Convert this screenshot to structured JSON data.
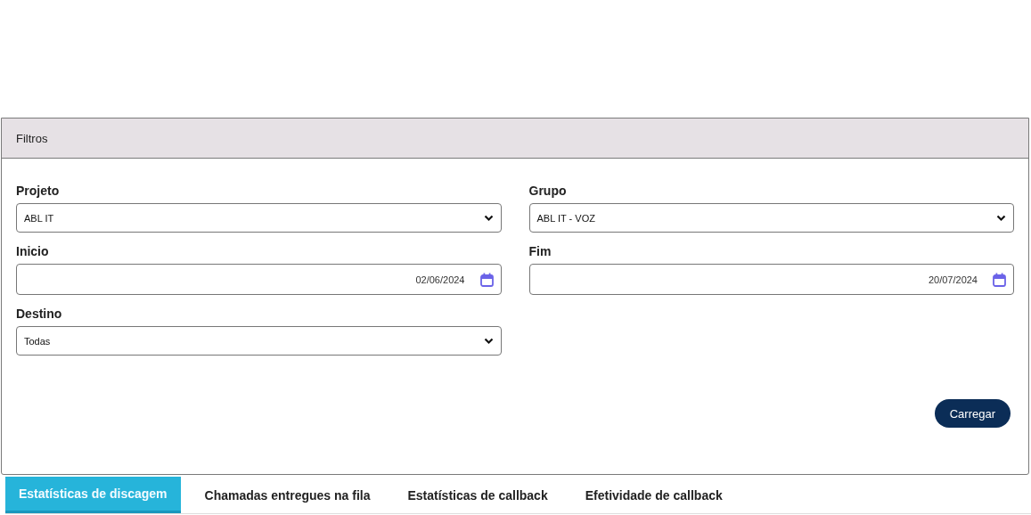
{
  "filters": {
    "title": "Filtros",
    "fields": [
      {
        "kind": "select",
        "label": "Projeto",
        "value": "ABL IT"
      },
      {
        "kind": "select",
        "label": "Grupo",
        "value": "ABL IT - VOZ"
      },
      {
        "kind": "date",
        "label": "Inicio",
        "value": "02/06/2024"
      },
      {
        "kind": "date",
        "label": "Fim",
        "value": "20/07/2024"
      },
      {
        "kind": "select",
        "label": "Destino",
        "value": "Todas"
      }
    ],
    "button": "Carregar"
  },
  "tabs": [
    {
      "label": "Estatísticas de discagem",
      "selected": true
    },
    {
      "label": "Chamadas entregues na fila",
      "selected": false
    },
    {
      "label": "Estatísticas de callback",
      "selected": false
    },
    {
      "label": "Efetividade de callback",
      "selected": false
    }
  ]
}
